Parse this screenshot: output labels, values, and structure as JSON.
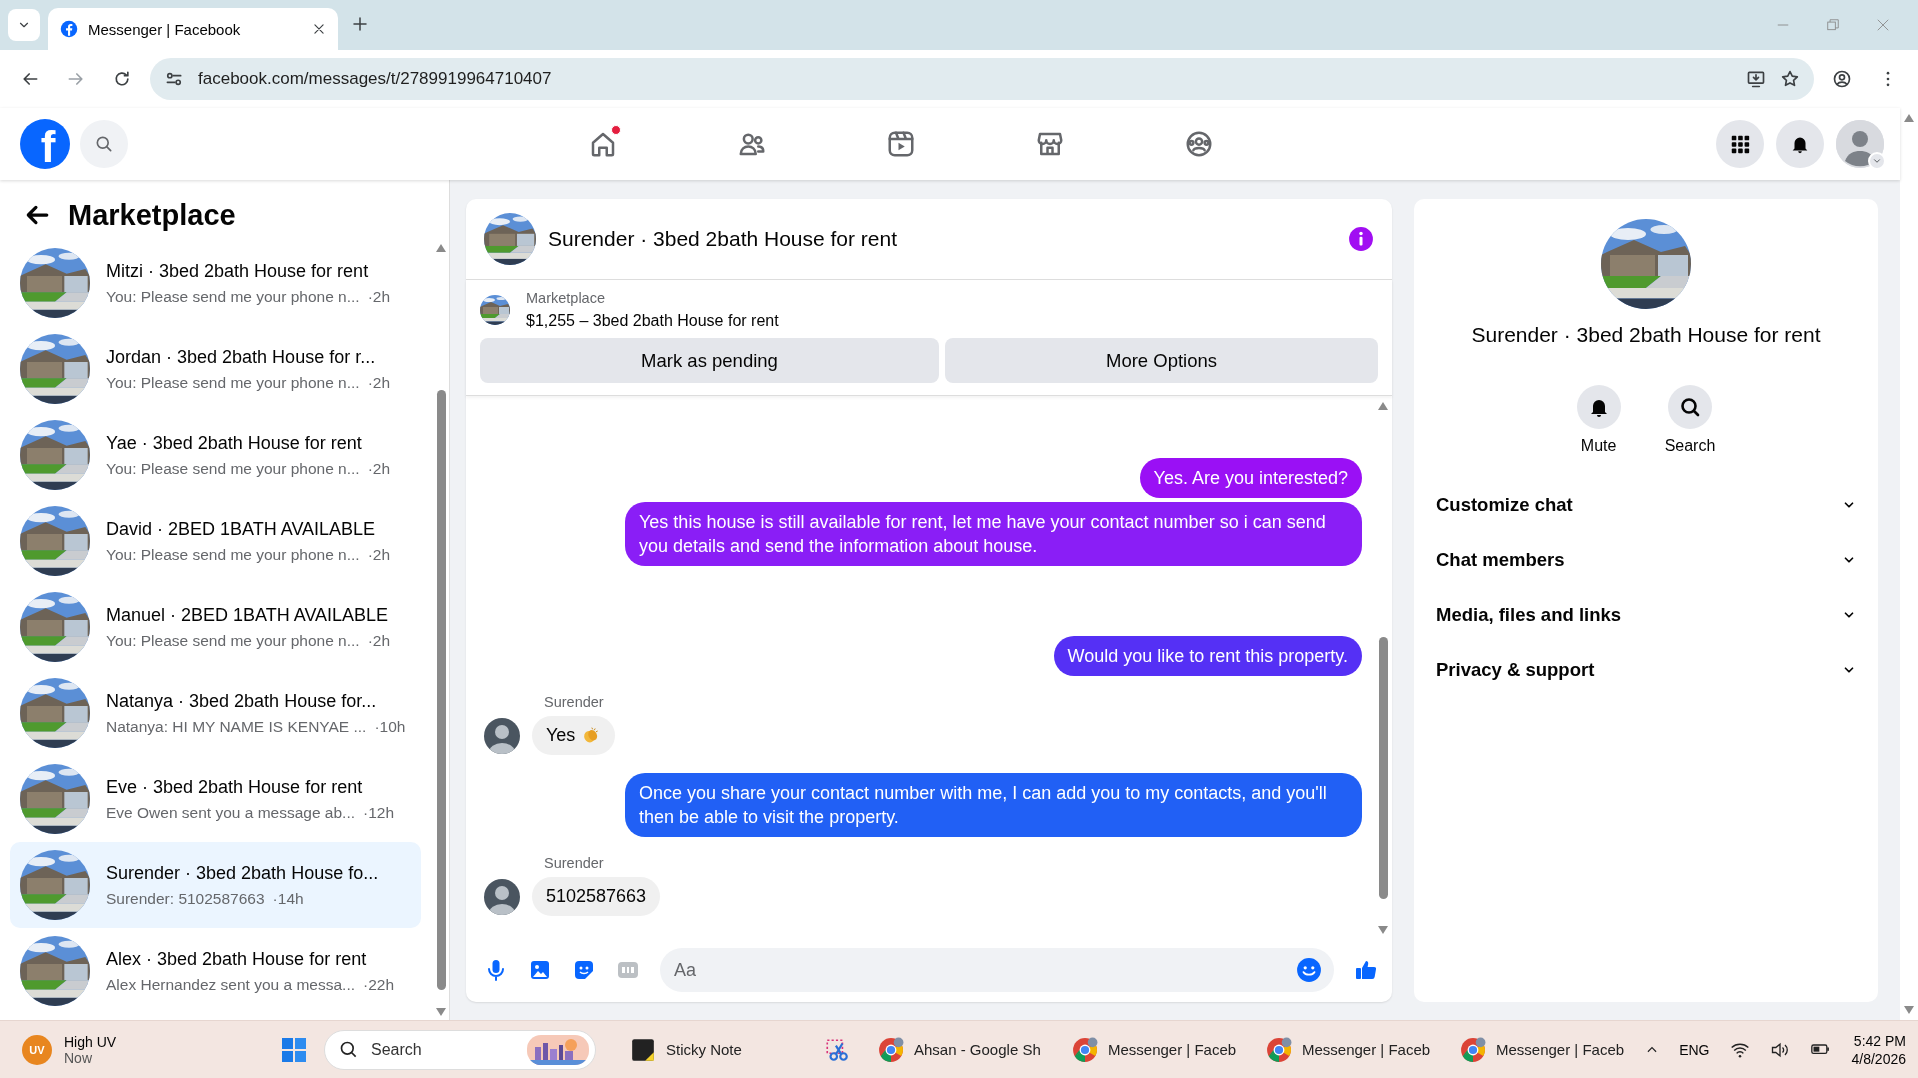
{
  "browser": {
    "tab_title": "Messenger | Facebook",
    "url": "facebook.com/messages/t/2789919964710407"
  },
  "header": {
    "logo": "f",
    "nav": [
      {
        "kind": "home",
        "dot": true
      },
      {
        "kind": "friends",
        "dot": false
      },
      {
        "kind": "video",
        "dot": false
      },
      {
        "kind": "marketplace",
        "dot": false
      },
      {
        "kind": "groups",
        "dot": false
      }
    ]
  },
  "sidebar": {
    "title": "Marketplace",
    "conversations": [
      {
        "title": "Mitzi · 3bed 2bath House for rent",
        "preview": "You: Please send me your phone n...",
        "time": "·2h",
        "selected": false
      },
      {
        "title": "Jordan · 3bed 2bath House for r...",
        "preview": "You: Please send me your phone n...",
        "time": "·2h",
        "selected": false
      },
      {
        "title": "Yae · 3bed 2bath House for rent",
        "preview": "You: Please send me your phone n...",
        "time": "·2h",
        "selected": false
      },
      {
        "title": "David · 2BED 1BATH AVAILABLE",
        "preview": "You: Please send me your phone n...",
        "time": "·2h",
        "selected": false
      },
      {
        "title": "Manuel · 2BED 1BATH AVAILABLE",
        "preview": "You: Please send me your phone n...",
        "time": "·2h",
        "selected": false
      },
      {
        "title": "Natanya · 3bed 2bath House for...",
        "preview": "Natanya: HI MY NAME IS KENYAE ...",
        "time": "·10h",
        "selected": false
      },
      {
        "title": "Eve · 3bed 2bath House for rent",
        "preview": "Eve Owen sent you a message ab...",
        "time": "·12h",
        "selected": false
      },
      {
        "title": "Surender · 3bed 2bath House fo...",
        "preview": "Surender: 5102587663",
        "time": "·14h",
        "selected": true
      },
      {
        "title": "Alex · 3bed 2bath House for rent",
        "preview": "Alex Hernandez sent you a messa...",
        "time": "·22h",
        "selected": false
      }
    ]
  },
  "chat": {
    "title": "Surender · 3bed 2bath House for rent",
    "listing": {
      "label": "Marketplace",
      "title": "$1,255 – 3bed 2bath House for rent",
      "buttons": [
        "Mark as pending",
        "More Options"
      ]
    },
    "groups": [
      {
        "kind": "sent",
        "messages": [
          {
            "text": "Yes. Are you interested?",
            "color": "#9a10f5"
          },
          {
            "text": "Yes this house is still available for rent, let me have your contact number so i can send you details and send the information about house.",
            "color": "#8a1ef6"
          }
        ]
      },
      {
        "kind": "sent",
        "messages": [
          {
            "text": "Would you like to rent this property.",
            "color": "#5530f5"
          }
        ]
      },
      {
        "kind": "received",
        "sender": "Surender",
        "messages": [
          {
            "text": "Yes",
            "clap": true
          }
        ]
      },
      {
        "kind": "sent",
        "messages": [
          {
            "text": "Once you share your contact number with me, I can add you to my contacts, and you'll then be able to visit the property.",
            "color": "#2160f5"
          }
        ]
      },
      {
        "kind": "received",
        "sender": "Surender",
        "messages": [
          {
            "text": "5102587663",
            "clap": false
          }
        ]
      }
    ],
    "composer": {
      "placeholder": "Aa"
    }
  },
  "details": {
    "title": "Surender · 3bed 2bath House for rent",
    "actions": [
      {
        "kind": "mute",
        "label": "Mute"
      },
      {
        "kind": "search",
        "label": "Search"
      }
    ],
    "sections": [
      {
        "label": "Customize chat",
        "expanded": false
      },
      {
        "label": "Chat members",
        "expanded": false
      },
      {
        "label": "Media, files and links",
        "expanded": false
      },
      {
        "label": "Privacy & support",
        "expanded": false
      }
    ]
  },
  "taskbar": {
    "weather": {
      "badge": "UV",
      "title": "High UV",
      "subtitle": "Now"
    },
    "search": {
      "placeholder": "Search"
    },
    "apps": [
      {
        "kind": "sticky",
        "label": "Sticky Note"
      },
      {
        "kind": "snip"
      },
      {
        "kind": "chrome",
        "label": "Ahsan - Google Sh"
      },
      {
        "kind": "chrome",
        "label": "Messenger | Faceb"
      },
      {
        "kind": "chrome",
        "label": "Messenger | Faceb"
      },
      {
        "kind": "chrome",
        "label": "Messenger | Faceb"
      }
    ],
    "tray": {
      "language": "ENG",
      "time": "5:42 PM",
      "date": "4/8/2026"
    }
  }
}
